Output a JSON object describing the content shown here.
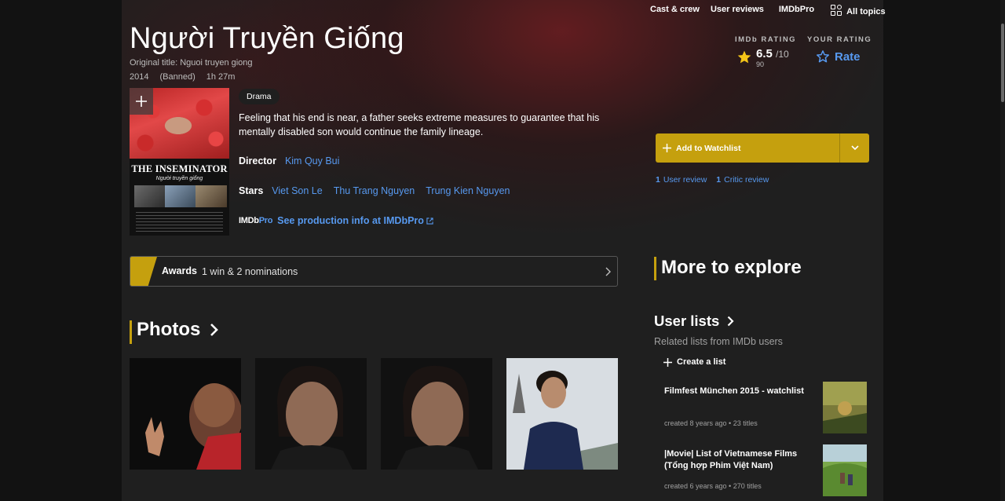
{
  "nav": {
    "cast_crew": "Cast & crew",
    "user_reviews": "User reviews",
    "imdbpro": "IMDbPro",
    "all_topics": "All topics"
  },
  "title": {
    "main": "Người Truyền Giống",
    "original": "Original title: Nguoi truyen giong",
    "year": "2014",
    "certificate": "(Banned)",
    "runtime": "1h 27m"
  },
  "rating": {
    "imdb_label": "IMDb RATING",
    "value": "6.5",
    "out_of": "/10",
    "count": "90",
    "your_label": "YOUR RATING",
    "rate_label": "Rate"
  },
  "poster": {
    "title": "THE INSEMINATOR",
    "subtitle": "Người truyền giống"
  },
  "genre": "Drama",
  "plot": "Feeling that his end is near, a father seeks extreme measures to guarantee that his mentally disabled son would continue the family lineage.",
  "director": {
    "label": "Director",
    "names": [
      "Kim Quy Bui"
    ]
  },
  "stars": {
    "label": "Stars",
    "names": [
      "Viet Son Le",
      "Thu Trang Nguyen",
      "Trung Kien Nguyen"
    ]
  },
  "imdbpro_link": {
    "logo_a": "IMDb",
    "logo_b": "Pro",
    "text": "See production info at IMDbPro"
  },
  "watchlist": {
    "label": "Add to Watchlist"
  },
  "reviews": {
    "user_count": "1",
    "user_label": "User review",
    "critic_count": "1",
    "critic_label": "Critic review"
  },
  "awards": {
    "label": "Awards",
    "value": "1 win & 2 nominations"
  },
  "photos": {
    "heading": "Photos"
  },
  "explore": {
    "heading": "More to explore",
    "lists_heading": "User lists",
    "lists_sub": "Related lists from IMDb users",
    "create_label": "Create a list",
    "lists": [
      {
        "name": "Filmfest München 2015 - watchlist",
        "info": "created 8 years ago • 23 titles"
      },
      {
        "name": "|Movie| List of Vietnamese Films (Tổng hợp Phim Việt Nam)",
        "info": "created 6 years ago • 270 titles"
      }
    ]
  },
  "colors": {
    "accent_gold": "#c5a00e",
    "link_blue": "#5799ef",
    "star_yellow": "#f5c518"
  },
  "icons": [
    "all-topics-icon",
    "star-icon",
    "star-outline-icon",
    "plus-icon",
    "chevron-down-icon",
    "chevron-right-icon",
    "external-link-icon"
  ]
}
